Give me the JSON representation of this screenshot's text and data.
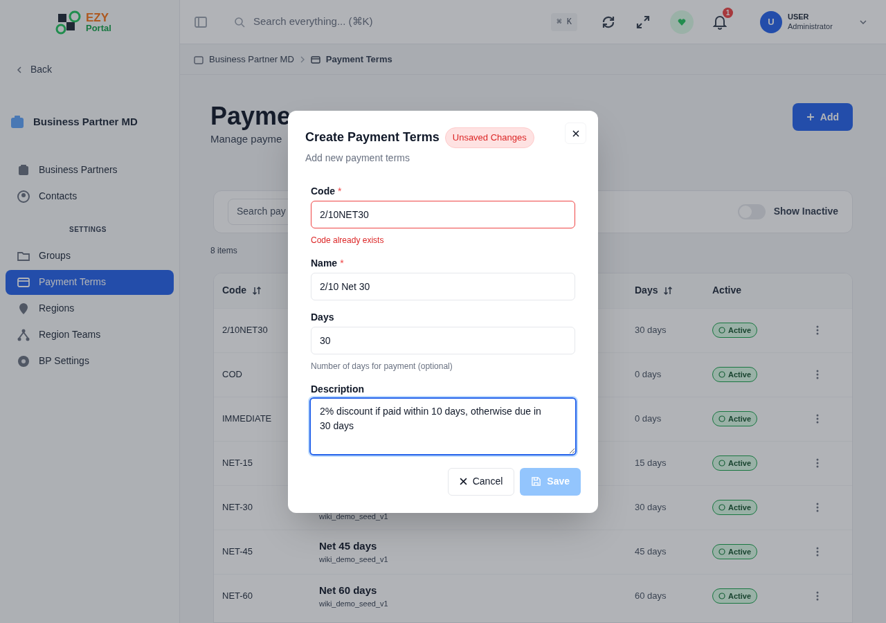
{
  "header": {
    "logo": [
      "EZY",
      "Portal"
    ],
    "search_placeholder": "Search everything... (⌘K)",
    "shortcut": "⌘ K",
    "notification_count": "1",
    "user": {
      "initial": "U",
      "name": "USER",
      "role": "Administrator"
    }
  },
  "sidebar": {
    "back": "Back",
    "module": "Business Partner MD",
    "items": [
      {
        "kind": "item",
        "label": "Business Partners",
        "selected": false
      },
      {
        "kind": "item",
        "label": "Contacts",
        "selected": false
      },
      {
        "kind": "section",
        "label": "SETTINGS"
      },
      {
        "kind": "item",
        "label": "Groups",
        "selected": false
      },
      {
        "kind": "item",
        "label": "Payment Terms",
        "selected": true
      },
      {
        "kind": "item",
        "label": "Regions",
        "selected": false
      },
      {
        "kind": "item",
        "label": "Region Teams",
        "selected": false
      },
      {
        "kind": "item",
        "label": "BP Settings",
        "selected": false
      }
    ]
  },
  "breadcrumb": [
    "Business Partner MD",
    "Payment Terms"
  ],
  "page": {
    "title": "Payme",
    "subtitle": "Manage payme",
    "add_button": "Add",
    "search_placeholder": "Search pay",
    "show_inactive": {
      "label": "Show Inactive",
      "on": false
    },
    "count": "8 items"
  },
  "table": {
    "columns": [
      {
        "label": "Code",
        "sortable": true
      },
      {
        "label": "Days",
        "sortable": true
      },
      {
        "label": "Active",
        "sortable": false
      }
    ],
    "rows": [
      {
        "code": "2/10NET30",
        "days": "30 days",
        "status": "Active"
      },
      {
        "code": "COD",
        "days": "0 days",
        "status": "Active"
      },
      {
        "code": "IMMEDIATE",
        "days": "0 days",
        "status": "Active"
      },
      {
        "code": "NET-15",
        "days": "15 days",
        "status": "Active"
      },
      {
        "code": "NET-30",
        "source": "wiki_demo_seed_v1",
        "days": "30 days",
        "status": "Active"
      },
      {
        "code": "NET-45",
        "name": "Net 45 days",
        "source": "wiki_demo_seed_v1",
        "days": "45 days",
        "status": "Active"
      },
      {
        "code": "NET-60",
        "name": "Net 60 days",
        "source": "wiki_demo_seed_v1",
        "days": "60 days",
        "status": "Active"
      }
    ]
  },
  "dialog": {
    "title": "Create Payment Terms",
    "badge": "Unsaved Changes",
    "subtitle": "Add new payment terms",
    "fields": [
      {
        "kind": "input",
        "label": "Code",
        "required_mark": "*",
        "value": "2/10NET30",
        "error": "Code already exists",
        "focused": false
      },
      {
        "kind": "input",
        "label": "Name",
        "required_mark": "*",
        "value": "2/10 Net 30",
        "focused": false
      },
      {
        "kind": "input",
        "label": "Days",
        "value": "30",
        "hint": "Number of days for payment (optional)",
        "focused": false
      },
      {
        "kind": "textarea",
        "label": "Description",
        "value": "2% discount if paid within 10 days, otherwise due in 30 days",
        "focused": true
      }
    ],
    "cancel": "Cancel",
    "save": {
      "label": "Save",
      "disabled": true
    }
  }
}
